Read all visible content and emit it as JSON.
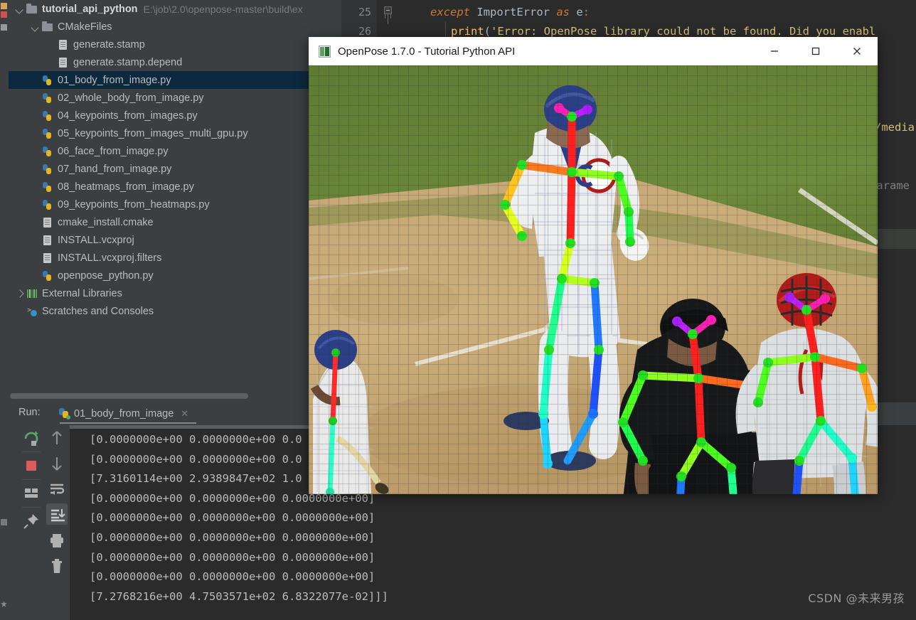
{
  "ide": {
    "project_tree": {
      "rows": [
        {
          "indent": 0,
          "twisty": "down",
          "icon": "folder-icon",
          "label": "tutorial_api_python",
          "bold": true,
          "path": "E:\\job\\2.0\\openpose-master\\build\\ex",
          "selected": false
        },
        {
          "indent": 1,
          "twisty": "down",
          "icon": "folder-icon",
          "label": "CMakeFiles",
          "bold": false,
          "path": "",
          "selected": false
        },
        {
          "indent": 2,
          "twisty": "none",
          "icon": "file-icon",
          "label": "generate.stamp",
          "bold": false,
          "path": "",
          "selected": false
        },
        {
          "indent": 2,
          "twisty": "none",
          "icon": "file-icon",
          "label": "generate.stamp.depend",
          "bold": false,
          "path": "",
          "selected": false
        },
        {
          "indent": 1,
          "twisty": "none",
          "icon": "python-file-icon",
          "label": "01_body_from_image.py",
          "bold": false,
          "path": "",
          "selected": true
        },
        {
          "indent": 1,
          "twisty": "none",
          "icon": "python-file-icon",
          "label": "02_whole_body_from_image.py",
          "bold": false,
          "path": "",
          "selected": false
        },
        {
          "indent": 1,
          "twisty": "none",
          "icon": "python-file-icon",
          "label": "04_keypoints_from_images.py",
          "bold": false,
          "path": "",
          "selected": false
        },
        {
          "indent": 1,
          "twisty": "none",
          "icon": "python-file-icon",
          "label": "05_keypoints_from_images_multi_gpu.py",
          "bold": false,
          "path": "",
          "selected": false
        },
        {
          "indent": 1,
          "twisty": "none",
          "icon": "python-file-icon",
          "label": "06_face_from_image.py",
          "bold": false,
          "path": "",
          "selected": false
        },
        {
          "indent": 1,
          "twisty": "none",
          "icon": "python-file-icon",
          "label": "07_hand_from_image.py",
          "bold": false,
          "path": "",
          "selected": false
        },
        {
          "indent": 1,
          "twisty": "none",
          "icon": "python-file-icon",
          "label": "08_heatmaps_from_image.py",
          "bold": false,
          "path": "",
          "selected": false
        },
        {
          "indent": 1,
          "twisty": "none",
          "icon": "python-file-icon",
          "label": "09_keypoints_from_heatmaps.py",
          "bold": false,
          "path": "",
          "selected": false
        },
        {
          "indent": 1,
          "twisty": "none",
          "icon": "file-icon",
          "label": "cmake_install.cmake",
          "bold": false,
          "path": "",
          "selected": false
        },
        {
          "indent": 1,
          "twisty": "none",
          "icon": "file-icon",
          "label": "INSTALL.vcxproj",
          "bold": false,
          "path": "",
          "selected": false
        },
        {
          "indent": 1,
          "twisty": "none",
          "icon": "file-icon",
          "label": "INSTALL.vcxproj.filters",
          "bold": false,
          "path": "",
          "selected": false
        },
        {
          "indent": 1,
          "twisty": "none",
          "icon": "python-file-icon",
          "label": "openpose_python.py",
          "bold": false,
          "path": "",
          "selected": false
        },
        {
          "indent": 0,
          "twisty": "right",
          "icon": "external-libraries-icon",
          "label": "External Libraries",
          "bold": false,
          "path": "",
          "selected": false
        },
        {
          "indent": 0,
          "twisty": "none",
          "icon": "scratches-icon",
          "label": "Scratches and Consoles",
          "bold": false,
          "path": "",
          "selected": false
        }
      ]
    },
    "left_rail": {
      "labels": [
        "Structure",
        "Favorites"
      ]
    },
    "editor": {
      "lines": [
        {
          "number": "25",
          "segments": [
            {
              "text": "except ",
              "style": "kw-it"
            },
            {
              "text": "ImportError ",
              "style": "cls"
            },
            {
              "text": "as ",
              "style": "kw-it"
            },
            {
              "text": "e",
              "style": "plain"
            },
            {
              "text": ":",
              "style": "kw"
            }
          ]
        },
        {
          "number": "26",
          "segments": [
            {
              "text": "print",
              "style": "fn"
            },
            {
              "text": "(",
              "style": "punct"
            },
            {
              "text": "'Error: OpenPose library could not be found. Did you enabl",
              "style": "str-y"
            }
          ]
        }
      ],
      "clipped_right": [
        {
          "text": "/media",
          "style": "str-y"
        },
        {
          "text": "parame",
          "style": "cmt"
        }
      ]
    },
    "run_panel": {
      "label": "Run:",
      "tab_name": "01_body_from_image",
      "tab_close": "✕",
      "toolbar_left": [
        {
          "name": "rerun-button",
          "title": "Rerun"
        },
        {
          "name": "stop-button",
          "title": "Stop"
        },
        {
          "name": "layout-button",
          "title": "Layout"
        },
        {
          "name": "pin-button",
          "title": "Pin Tab"
        }
      ],
      "toolbar_right": [
        {
          "name": "up-arrow-button",
          "title": "Up"
        },
        {
          "name": "down-arrow-button",
          "title": "Down"
        },
        {
          "name": "soft-wrap-button",
          "title": "Soft-Wrap"
        },
        {
          "name": "scroll-to-end-button",
          "title": "Scroll to End",
          "active": true
        },
        {
          "name": "print-button",
          "title": "Print"
        },
        {
          "name": "trash-button",
          "title": "Clear All"
        }
      ],
      "console_lines": [
        "[0.0000000e+00 0.0000000e+00 0.0",
        "[0.0000000e+00 0.0000000e+00 0.0",
        "[7.3160114e+00 2.9389847e+02 1.0",
        "[0.0000000e+00 0.0000000e+00 0.0000000e+00]",
        "[0.0000000e+00 0.0000000e+00 0.0000000e+00]",
        "[0.0000000e+00 0.0000000e+00 0.0000000e+00]",
        "[0.0000000e+00 0.0000000e+00 0.0000000e+00]",
        "[0.0000000e+00 0.0000000e+00 0.0000000e+00]",
        "[7.2768216e+00 4.7503571e+02 6.8322077e-02]]]"
      ]
    }
  },
  "openpose_window": {
    "title": "OpenPose 1.7.0 - Tutorial Python API",
    "icon": "openpose-app-icon",
    "controls": [
      {
        "name": "minimize-button",
        "glyph": "minimize"
      },
      {
        "name": "maximize-button",
        "glyph": "maximize"
      },
      {
        "name": "close-button",
        "glyph": "close"
      }
    ],
    "image_description": "Baseball scene with OpenPose body skeleton keypoints overlaid on four players"
  },
  "watermark": "CSDN @未来男孩",
  "colors": {
    "ide_bg": "#3c3f41",
    "editor_bg": "#2b2b2b",
    "selection": "#0d293e",
    "accent_green": "#59a869",
    "accent_red": "#db5c5c",
    "text": "#bbbbbb"
  }
}
